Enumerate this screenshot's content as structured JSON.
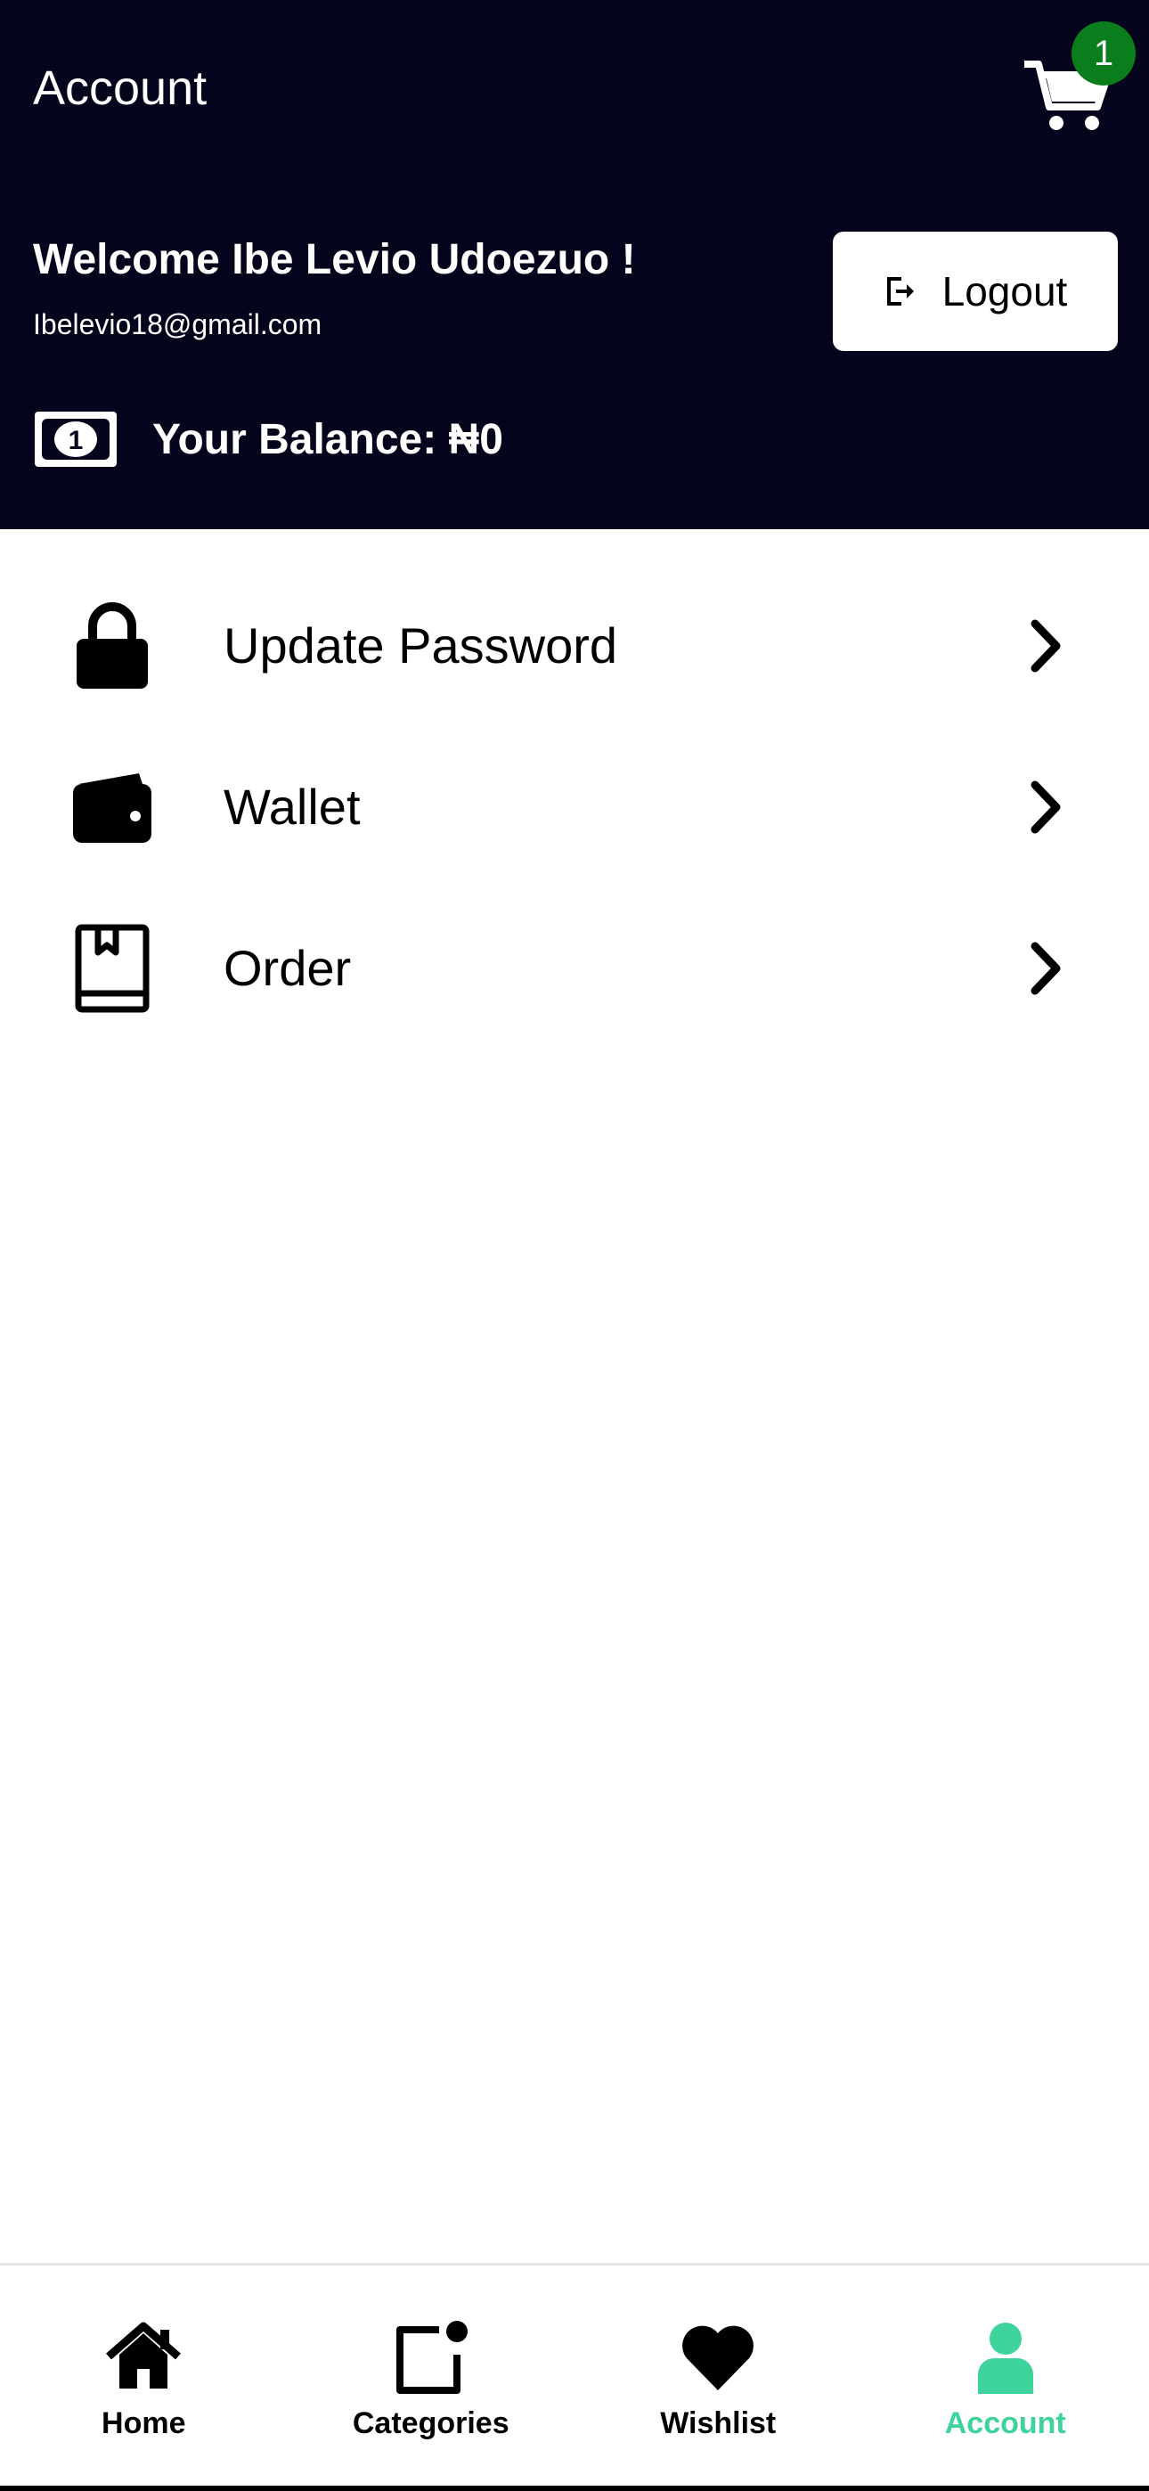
{
  "header": {
    "title": "Account",
    "cart_count": "1",
    "welcome": "Welcome Ibe Levio Udoezuo !",
    "email": "Ibelevio18@gmail.com",
    "logout_label": "Logout",
    "balance_text": "Your Balance: ₦0"
  },
  "menu": {
    "items": [
      {
        "label": "Update Password",
        "icon": "lock-icon"
      },
      {
        "label": "Wallet",
        "icon": "wallet-icon"
      },
      {
        "label": "Order",
        "icon": "book-icon"
      }
    ]
  },
  "bottom_nav": {
    "items": [
      {
        "label": "Home",
        "icon": "home-icon",
        "active": false
      },
      {
        "label": "Categories",
        "icon": "categories-icon",
        "active": false
      },
      {
        "label": "Wishlist",
        "icon": "heart-icon",
        "active": false
      },
      {
        "label": "Account",
        "icon": "user-icon",
        "active": true
      }
    ]
  },
  "colors": {
    "header_bg": "#04041c",
    "badge": "#0a7d1d",
    "active": "#3ed39b"
  }
}
